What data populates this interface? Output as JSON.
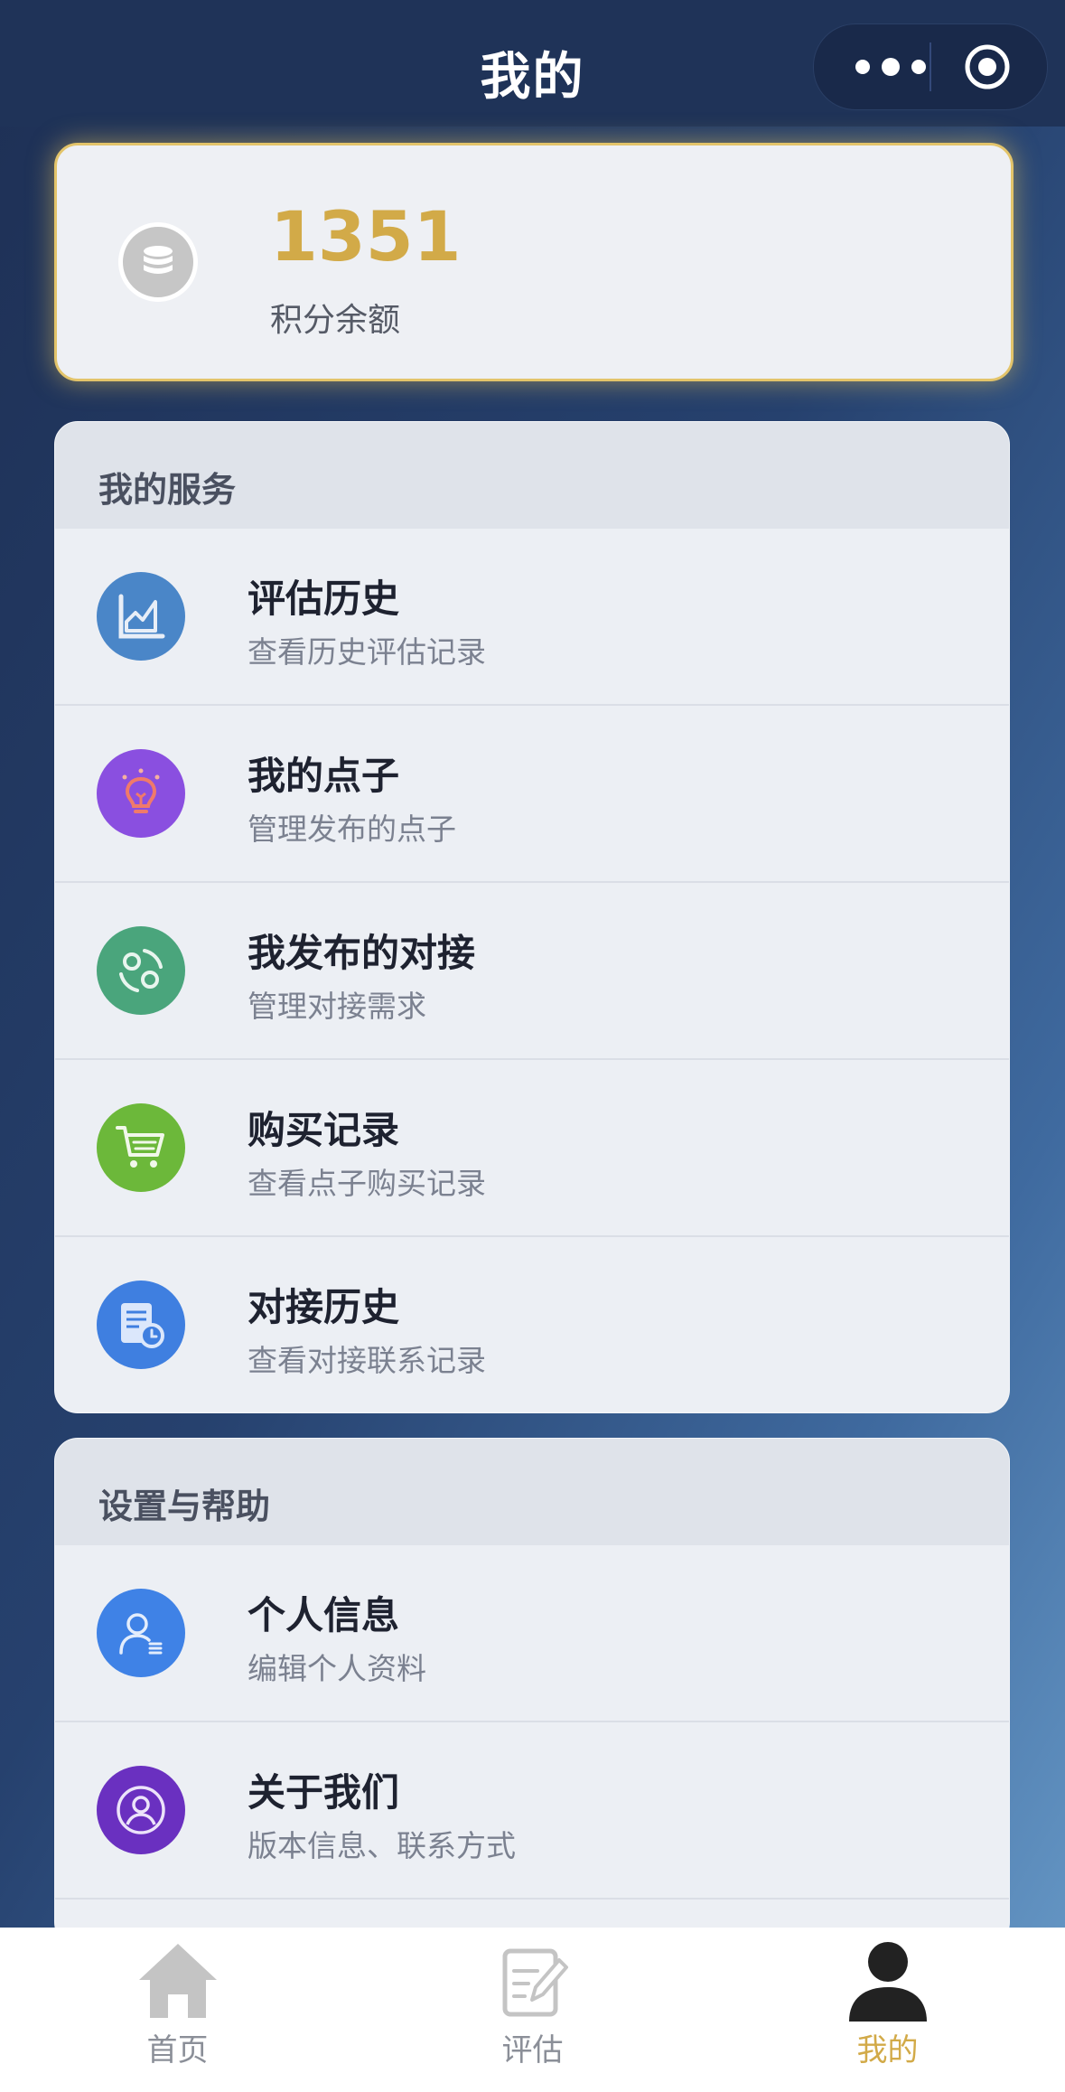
{
  "navbar": {
    "title": "我的"
  },
  "points": {
    "value": "1351",
    "label": "积分余额"
  },
  "services": {
    "title": "我的服务",
    "items": [
      {
        "title": "评估历史",
        "subtitle": "查看历史评估记录",
        "icon": "chart-icon",
        "color": "#4a86c8"
      },
      {
        "title": "我的点子",
        "subtitle": "管理发布的点子",
        "icon": "lightbulb-icon",
        "color": "#8a4fe0"
      },
      {
        "title": "我发布的对接",
        "subtitle": "管理对接需求",
        "icon": "connect-icon",
        "color": "#4aa57c"
      },
      {
        "title": "购买记录",
        "subtitle": "查看点子购买记录",
        "icon": "cart-icon",
        "color": "#6cb83a"
      },
      {
        "title": "对接历史",
        "subtitle": "查看对接联系记录",
        "icon": "document-clock-icon",
        "color": "#3f7fe0"
      }
    ]
  },
  "settings": {
    "title": "设置与帮助",
    "items": [
      {
        "title": "个人信息",
        "subtitle": "编辑个人资料",
        "icon": "user-profile-icon",
        "color": "#3f82e6"
      },
      {
        "title": "关于我们",
        "subtitle": "版本信息、联系方式",
        "icon": "user-circle-icon",
        "color": "#6a30c0"
      }
    ]
  },
  "tabbar": {
    "items": [
      {
        "label": "首页",
        "icon": "home-icon"
      },
      {
        "label": "评估",
        "icon": "edit-doc-icon"
      },
      {
        "label": "我的",
        "icon": "person-icon",
        "active": true
      }
    ]
  },
  "colors": {
    "accent": "#d2aa48",
    "nav": "#1f3358"
  }
}
